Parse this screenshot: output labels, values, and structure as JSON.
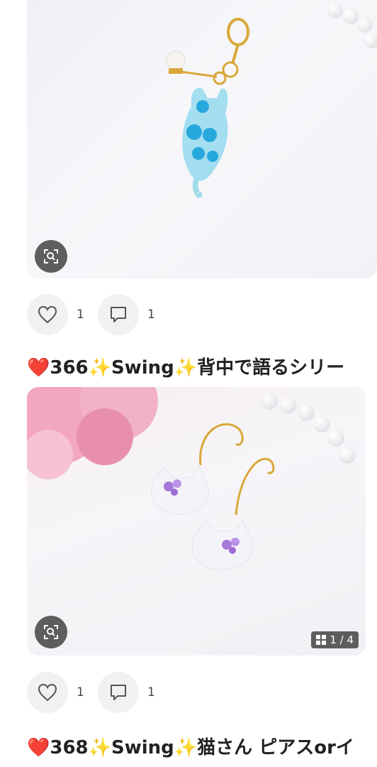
{
  "posts": [
    {
      "likes": "1",
      "comments": "1",
      "title": "❤️366✨Swing✨背中で語るシリー"
    },
    {
      "likes": "1",
      "comments": "1",
      "title": "❤️368✨Swing✨猫さん ピアスorイ",
      "page_indicator": "1 / 4"
    }
  ],
  "icons": {
    "lens": "image-search-icon",
    "like": "heart-outline-icon",
    "comment": "comment-bubble-icon",
    "gallery": "gallery-grid-icon"
  }
}
